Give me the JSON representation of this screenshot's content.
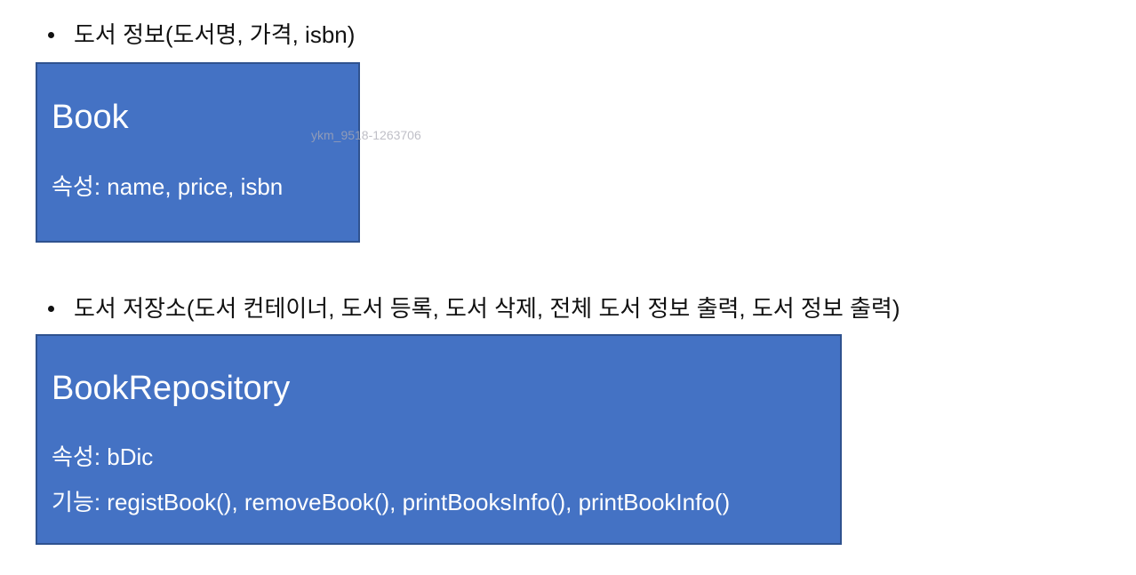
{
  "bullets": [
    {
      "text": "도서 정보(도서명, 가격, isbn)"
    },
    {
      "text": "도서 저장소(도서 컨테이너, 도서 등록, 도서 삭제, 전체 도서 정보 출력, 도서 정보 출력)"
    }
  ],
  "classes": [
    {
      "title": "Book",
      "attributes": "속성: name, price, isbn"
    },
    {
      "title": "BookRepository",
      "attributes": "속성: bDic",
      "functions": "기능: registBook(), removeBook(), printBooksInfo(), printBookInfo()"
    }
  ],
  "watermark": "ykm_9518-1263706",
  "colors": {
    "box_fill": "#4472c4",
    "box_border": "#2f528f",
    "box_text": "#ffffff"
  }
}
